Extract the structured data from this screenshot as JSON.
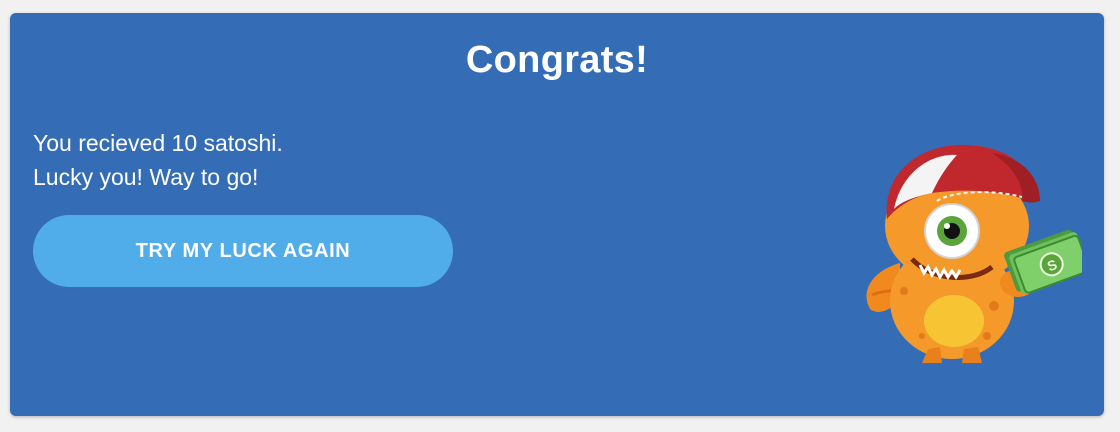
{
  "dialog": {
    "title": "Congrats!",
    "message_line1": "You recieved 10 satoshi.",
    "message_line2": "Lucky you! Way to go!",
    "button_label": "TRY MY LUCK AGAIN"
  },
  "colors": {
    "background": "#346db5",
    "button": "#51ade9",
    "text": "#ffffff",
    "mascot_body": "#f59a2a",
    "cap_red": "#c0282d",
    "money_green": "#5cb85c"
  },
  "icons": {
    "mascot": "monster-mascot-icon"
  }
}
